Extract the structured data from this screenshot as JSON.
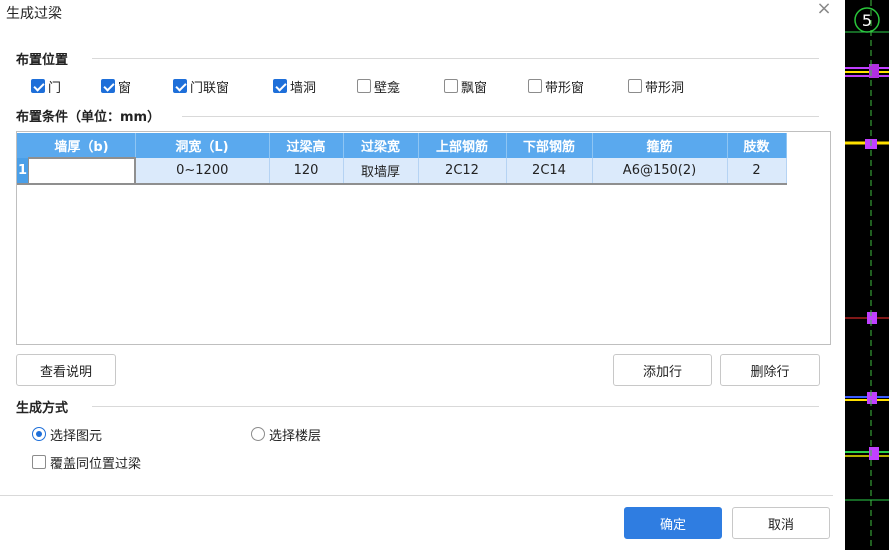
{
  "dialog": {
    "title": "生成过梁",
    "close_symbol": "×"
  },
  "placement": {
    "section_label": "布置位置",
    "options": [
      {
        "label": "门",
        "checked": true
      },
      {
        "label": "窗",
        "checked": true
      },
      {
        "label": "门联窗",
        "checked": true
      },
      {
        "label": "墙洞",
        "checked": true
      },
      {
        "label": "壁龛",
        "checked": false
      },
      {
        "label": "飘窗",
        "checked": false
      },
      {
        "label": "带形窗",
        "checked": false
      },
      {
        "label": "带形洞",
        "checked": false
      }
    ]
  },
  "conditions": {
    "section_label": "布置条件（单位：mm）",
    "columns": [
      "墙厚（b)",
      "洞宽（L)",
      "过梁高",
      "过梁宽",
      "上部钢筋",
      "下部钢筋",
      "箍筋",
      "肢数"
    ],
    "rows": [
      {
        "index": "1",
        "cells": [
          "",
          "0~1200",
          "120",
          "取墙厚",
          "2C12",
          "2C14",
          "A6@150(2)",
          "2"
        ]
      }
    ]
  },
  "buttons": {
    "view_help": "查看说明",
    "add_row": "添加行",
    "delete_row": "删除行",
    "ok": "确定",
    "cancel": "取消"
  },
  "generate": {
    "section_label": "生成方式",
    "select_element": "选择图元",
    "select_floor": "选择楼层",
    "selected": "select_element",
    "overwrite_label": "覆盖同位置过梁",
    "overwrite_checked": false
  },
  "cad": {
    "axis_label": "5"
  }
}
